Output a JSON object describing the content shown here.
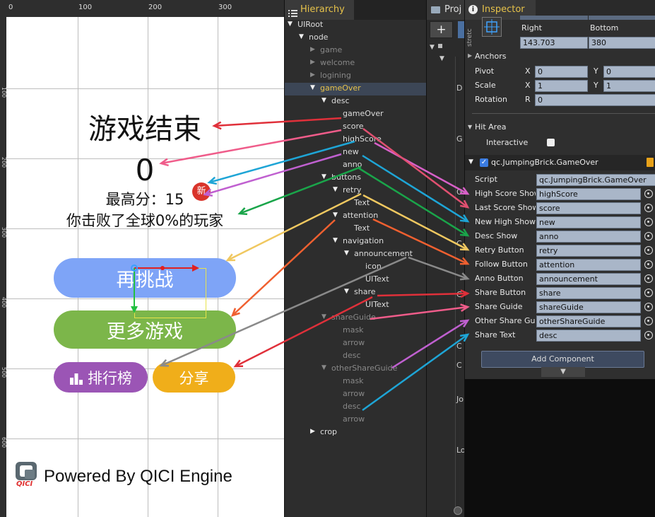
{
  "ruler": {
    "ticks": [
      "0",
      "100",
      "200",
      "300"
    ],
    "vticks": [
      "100",
      "200",
      "300",
      "400",
      "500",
      "600"
    ]
  },
  "game": {
    "title": "游戏结束",
    "score": "0",
    "high_score": "最高分：15",
    "new_badge": "新",
    "defeat_text": "你击败了全球0%的玩家",
    "retry_label": "再挑战",
    "more_games_label": "更多游戏",
    "rank_label": "排行榜",
    "share_label": "分享",
    "powered_text": "Powered By QICI Engine",
    "logo_text": "QICI"
  },
  "hierarchy": {
    "tab": "Hierarchy",
    "rows": [
      {
        "label": "UIRoot",
        "caret": "down",
        "indent": 0,
        "state": "normal"
      },
      {
        "label": "node",
        "caret": "down",
        "indent": 1,
        "state": "normal"
      },
      {
        "label": "game",
        "caret": "right",
        "indent": 2,
        "state": "dim"
      },
      {
        "label": "welcome",
        "caret": "right",
        "indent": 2,
        "state": "dim"
      },
      {
        "label": "logining",
        "caret": "right",
        "indent": 2,
        "state": "dim"
      },
      {
        "label": "gameOver",
        "caret": "down",
        "indent": 2,
        "state": "selected"
      },
      {
        "label": "desc",
        "caret": "down",
        "indent": 3,
        "state": "normal"
      },
      {
        "label": "gameOver",
        "caret": "",
        "indent": 4,
        "state": "normal"
      },
      {
        "label": "score",
        "caret": "",
        "indent": 4,
        "state": "normal"
      },
      {
        "label": "highScore",
        "caret": "",
        "indent": 4,
        "state": "normal"
      },
      {
        "label": "new",
        "caret": "",
        "indent": 4,
        "state": "normal"
      },
      {
        "label": "anno",
        "caret": "",
        "indent": 4,
        "state": "normal"
      },
      {
        "label": "buttons",
        "caret": "down",
        "indent": 3,
        "state": "normal"
      },
      {
        "label": "retry",
        "caret": "down",
        "indent": 4,
        "state": "normal"
      },
      {
        "label": "Text",
        "caret": "",
        "indent": 5,
        "state": "normal"
      },
      {
        "label": "attention",
        "caret": "down",
        "indent": 4,
        "state": "normal"
      },
      {
        "label": "Text",
        "caret": "",
        "indent": 5,
        "state": "normal"
      },
      {
        "label": "navigation",
        "caret": "down",
        "indent": 4,
        "state": "normal"
      },
      {
        "label": "announcement",
        "caret": "down",
        "indent": 5,
        "state": "normal"
      },
      {
        "label": "icon",
        "caret": "",
        "indent": 6,
        "state": "normal"
      },
      {
        "label": "UIText",
        "caret": "",
        "indent": 6,
        "state": "normal"
      },
      {
        "label": "share",
        "caret": "down",
        "indent": 5,
        "state": "normal"
      },
      {
        "label": "UIText",
        "caret": "",
        "indent": 6,
        "state": "normal"
      },
      {
        "label": "shareGuide",
        "caret": "down",
        "indent": 3,
        "state": "dim"
      },
      {
        "label": "mask",
        "caret": "",
        "indent": 4,
        "state": "dim"
      },
      {
        "label": "arrow",
        "caret": "",
        "indent": 4,
        "state": "dim"
      },
      {
        "label": "desc",
        "caret": "",
        "indent": 4,
        "state": "dim"
      },
      {
        "label": "otherShareGuide",
        "caret": "down",
        "indent": 3,
        "state": "dim"
      },
      {
        "label": "mask",
        "caret": "",
        "indent": 4,
        "state": "dim"
      },
      {
        "label": "arrow",
        "caret": "",
        "indent": 4,
        "state": "dim"
      },
      {
        "label": "desc",
        "caret": "",
        "indent": 4,
        "state": "dim"
      },
      {
        "label": "arrow",
        "caret": "",
        "indent": 4,
        "state": "dim"
      },
      {
        "label": "crop",
        "caret": "right",
        "indent": 2,
        "state": "normal"
      }
    ]
  },
  "project": {
    "tab": "Proj",
    "add_label": "+",
    "side_letters": [
      "D",
      "G",
      "G",
      "C",
      "C",
      "C",
      "C",
      "Jo",
      "Lo"
    ]
  },
  "inspector": {
    "tab": "Inspector",
    "stretch_label": "stretc",
    "right_label": "Right",
    "bottom_label": "Bottom",
    "right_value": "143.703",
    "bottom_value": "380",
    "anchors_label": "Anchors",
    "pivot_label": "Pivot",
    "pivot_x": "0",
    "pivot_y": "0",
    "scale_label": "Scale",
    "scale_x": "1",
    "scale_y": "1",
    "rotation_label": "Rotation",
    "rotation_r": "0",
    "x_label": "X",
    "y_label": "Y",
    "r_label": "R",
    "hit_area_label": "Hit Area",
    "interactive_label": "Interactive",
    "component_title": "qc.JumpingBrick.GameOver",
    "script_label": "Script",
    "script_value": "qc.JumpingBrick.GameOver",
    "fields": [
      {
        "label": "High Score Show",
        "value": "highScore"
      },
      {
        "label": "Last Score Show",
        "value": "score"
      },
      {
        "label": "New High Show",
        "value": "new"
      },
      {
        "label": "Desc Show",
        "value": "anno"
      },
      {
        "label": "Retry Button",
        "value": "retry"
      },
      {
        "label": "Follow Button",
        "value": "attention"
      },
      {
        "label": "Anno Button",
        "value": "announcement"
      },
      {
        "label": "Share Button",
        "value": "share"
      },
      {
        "label": "Share Guide",
        "value": "shareGuide"
      },
      {
        "label": "Other Share Guid",
        "value": "otherShareGuide"
      },
      {
        "label": "Share Text",
        "value": "desc"
      }
    ],
    "add_component_label": "Add Component"
  },
  "colors": {
    "retry": "#7ea4f7",
    "more": "#7cb64a",
    "rank": "#9b55b5",
    "share": "#f0ae1a",
    "selected_text": "#e6c24a"
  }
}
